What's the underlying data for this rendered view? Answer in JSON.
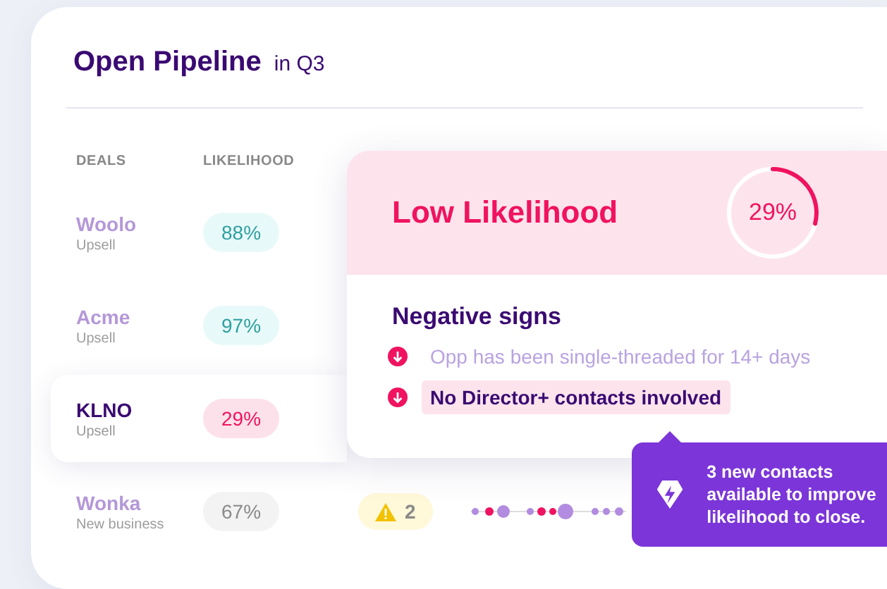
{
  "title": "Open Pipeline",
  "subtitle": "in Q3",
  "columns": [
    "DEALS",
    "LIKELIHOOD"
  ],
  "deals": [
    {
      "name": "Woolo",
      "type": "Upsell",
      "likelihood": "88%",
      "kind": "high",
      "selected": false
    },
    {
      "name": "Acme",
      "type": "Upsell",
      "likelihood": "97%",
      "kind": "high",
      "selected": false
    },
    {
      "name": "KLNO",
      "type": "Upsell",
      "likelihood": "29%",
      "kind": "low",
      "selected": true
    },
    {
      "name": "Wonka",
      "type": "New business",
      "likelihood": "67%",
      "kind": "medium",
      "selected": false,
      "warnings": "2"
    }
  ],
  "insight": {
    "heading": "Low Likelihood",
    "percent": "29%",
    "signs_title": "Negative signs",
    "signs": [
      {
        "text": "Opp has been single-threaded for 14+ days",
        "highlighted": false
      },
      {
        "text": "No Director+ contacts involved",
        "highlighted": true
      }
    ]
  },
  "tooltip": {
    "text": "3 new contacts available to improve likelihood to close."
  }
}
